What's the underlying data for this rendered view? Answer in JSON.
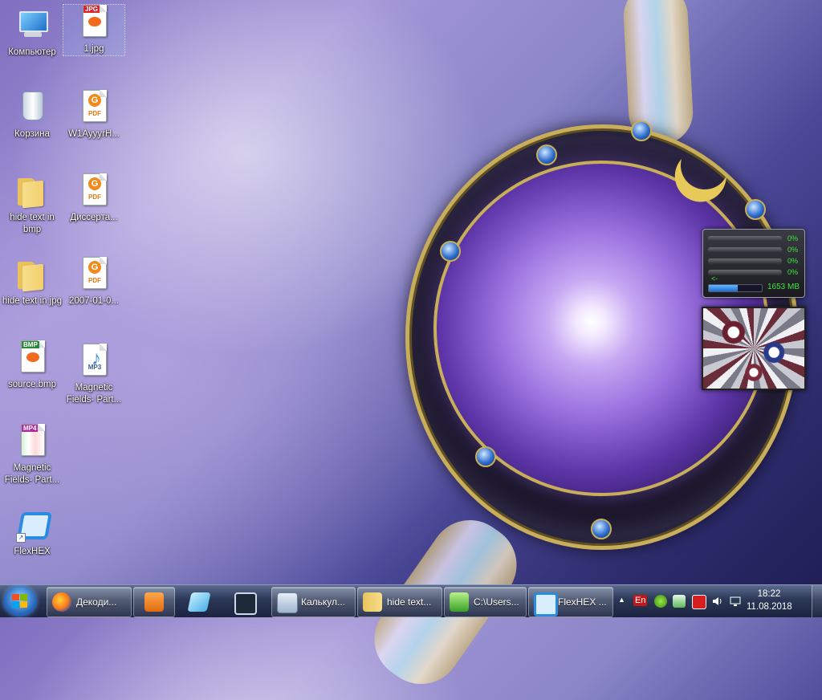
{
  "desktop": {
    "icons": [
      {
        "label": "Компьютер",
        "type": "computer-icon"
      },
      {
        "label": "1.jpg",
        "type": "jpg-file-icon",
        "badge": "JPG"
      },
      {
        "label": "Корзина",
        "type": "recycle-bin-icon"
      },
      {
        "label": "W1AyyyrH...",
        "type": "pdf-file-icon",
        "badge": "PDF"
      },
      {
        "label": "hide text in bmp",
        "type": "folder-icon"
      },
      {
        "label": "Диссерта...",
        "type": "pdf-file-icon",
        "badge": "PDF"
      },
      {
        "label": "hide text in jpg",
        "type": "folder-icon"
      },
      {
        "label": "2007-01-0...",
        "type": "pdf-file-icon",
        "badge": "PDF"
      },
      {
        "label": "source.bmp",
        "type": "bmp-file-icon",
        "badge": "BMP"
      },
      {
        "label": "Magnetic Fields- Part...",
        "type": "mp3-file-icon",
        "badge": "MP3"
      },
      {
        "label": "Magnetic Fields- Part...",
        "type": "mp4-file-icon",
        "badge": "MP4"
      },
      {
        "label": "FlexHEX",
        "type": "flexhex-shortcut-icon"
      }
    ]
  },
  "gadgets": {
    "cpu_meter": {
      "cores": [
        "0%",
        "0%",
        "0%",
        "0%"
      ],
      "arrow": "<-",
      "memory": "1653 MB",
      "memory_fill": 0.55
    }
  },
  "taskbar": {
    "buttons": [
      {
        "label": "Декоди...",
        "icon": "firefox-icon"
      },
      {
        "label": "",
        "icon": "media-player-icon"
      },
      {
        "label": "",
        "icon": "paint-icon"
      },
      {
        "label": "",
        "icon": "virtual-desktop-icon"
      },
      {
        "label": "Калькул...",
        "icon": "calculator-icon"
      },
      {
        "label": "hide text...",
        "icon": "folder-icon"
      },
      {
        "label": "C:\\Users...",
        "icon": "notepad-plus-icon"
      },
      {
        "label": "FlexHEX ...",
        "icon": "flexhex-icon"
      }
    ],
    "tray": {
      "overflow": "▲",
      "language": "En",
      "time": "18:22",
      "date": "11.08.2018"
    }
  },
  "colors": {
    "cpu_text": "#3fe83f",
    "taskbar": "#2a3756",
    "accent_gold": "#c8ad5a"
  }
}
